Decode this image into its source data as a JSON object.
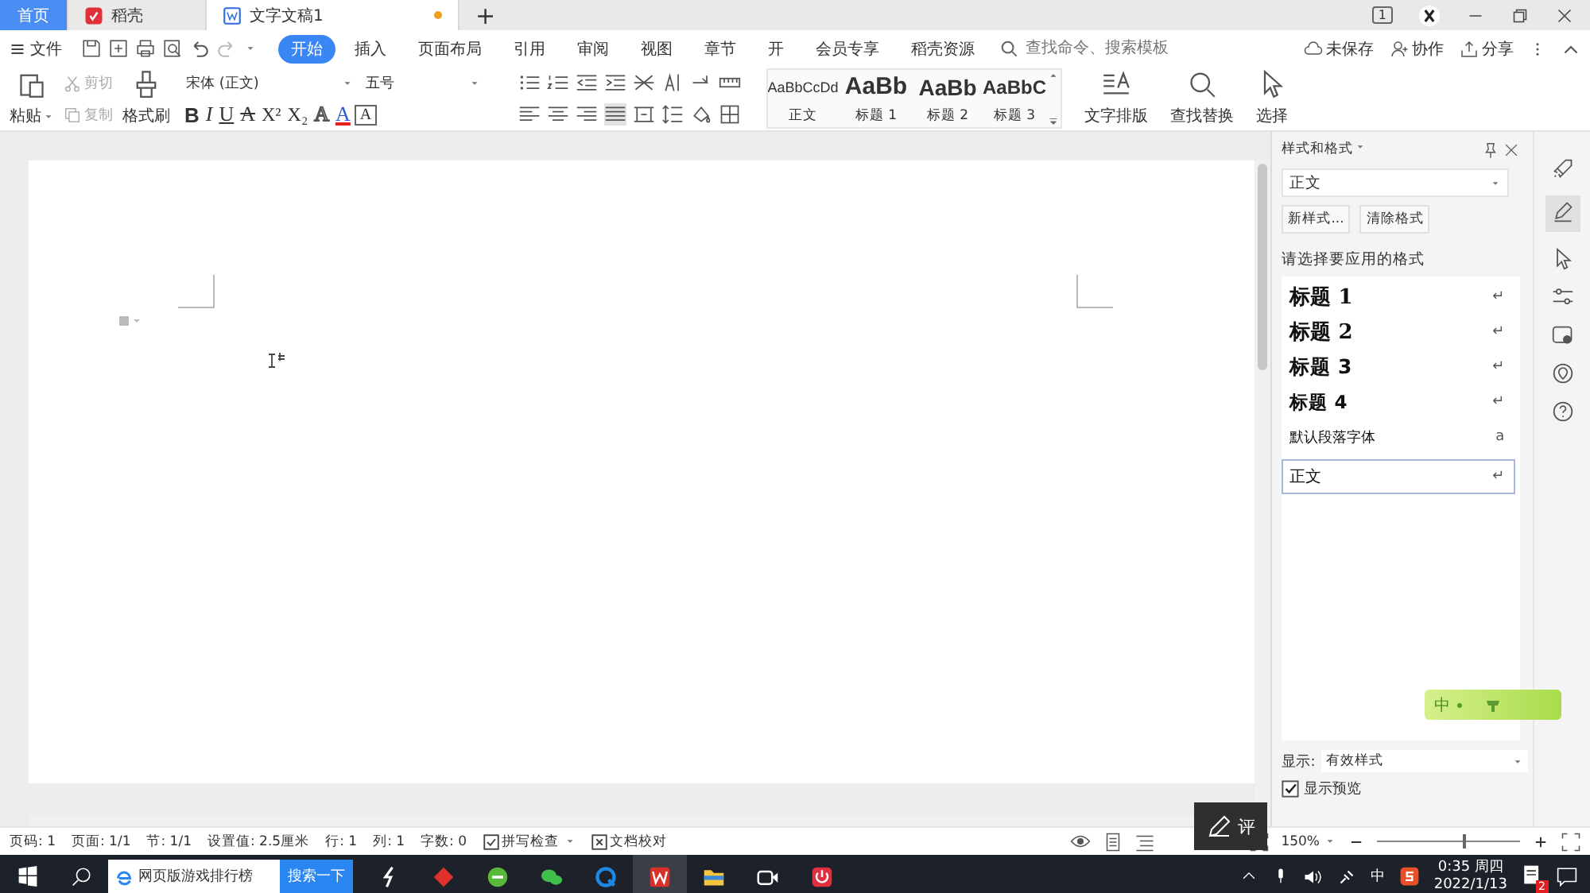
{
  "title_tabs": [
    {
      "label": "首页",
      "kind": "home",
      "selected": false
    },
    {
      "label": "稻壳",
      "kind": "docer",
      "selected": false
    },
    {
      "label": "文字文稿1",
      "kind": "doc",
      "selected": true,
      "unsaved": true
    }
  ],
  "new_tab": "+",
  "window_badge": "1",
  "menu": {
    "file": "文件",
    "tabs": [
      {
        "label": "开始",
        "selected": true
      },
      {
        "label": "插入",
        "selected": false
      },
      {
        "label": "页面布局",
        "selected": false
      },
      {
        "label": "引用",
        "selected": false
      },
      {
        "label": "审阅",
        "selected": false
      },
      {
        "label": "视图",
        "selected": false
      },
      {
        "label": "章节",
        "selected": false
      },
      {
        "label": "开",
        "selected": false
      },
      {
        "label": "会员专享",
        "selected": false
      },
      {
        "label": "稻壳资源",
        "selected": false
      }
    ],
    "search_placeholder": "查找命令、搜索模板",
    "actions": [
      {
        "label": "未保存",
        "kind": "cloud"
      },
      {
        "label": "协作",
        "kind": "user"
      },
      {
        "label": "分享",
        "kind": "share"
      }
    ]
  },
  "ribbon": {
    "paste": "粘贴",
    "cut": {
      "label": "剪切",
      "disabled": true
    },
    "copy": {
      "label": "复制",
      "disabled": true
    },
    "painter": "格式刷",
    "font": "宋体 (正文)",
    "size": "五号",
    "font_buttons": [
      {
        "glyph": "B",
        "kind": "bold"
      },
      {
        "glyph": "I",
        "kind": "italic"
      },
      {
        "glyph": "U",
        "kind": "underline"
      },
      {
        "glyph": "A",
        "kind": "strike"
      },
      {
        "glyph": "X²",
        "kind": "plain"
      },
      {
        "glyph": "X₂",
        "kind": "plain"
      },
      {
        "glyph": "A",
        "kind": "outline"
      },
      {
        "glyph": "A",
        "kind": "color"
      },
      {
        "glyph": "A",
        "kind": "boxed"
      }
    ],
    "styles": [
      {
        "preview": "AaBbCcDd",
        "label": "正文",
        "kind": "normal"
      },
      {
        "preview": "AaBb",
        "label": "标题 1",
        "kind": "h1"
      },
      {
        "preview": "AaBb",
        "label": "标题 2",
        "kind": "h2"
      },
      {
        "preview": "AaBbC",
        "label": "标题 3",
        "kind": "h3"
      }
    ],
    "big_buttons": [
      {
        "label": "文字排版",
        "kind": "layout"
      },
      {
        "label": "查找替换",
        "kind": "find"
      },
      {
        "label": "选择",
        "kind": "select"
      }
    ]
  },
  "panel": {
    "title": "样式和格式",
    "current": "正文",
    "buttons": [
      "新样式...",
      "清除格式"
    ],
    "prompt": "请选择要应用的格式",
    "styles": [
      {
        "label": "标题 1",
        "kind": "h1",
        "mark": "↵",
        "selected": false
      },
      {
        "label": "标题 2",
        "kind": "h2",
        "mark": "↵",
        "selected": false
      },
      {
        "label": "标题 3",
        "kind": "h3",
        "mark": "↵",
        "selected": false
      },
      {
        "label": "标题 4",
        "kind": "h4",
        "mark": "↵",
        "selected": false
      },
      {
        "label": "默认段落字体",
        "kind": "font",
        "mark": "a",
        "selected": false
      },
      {
        "label": "正文",
        "kind": "normal",
        "mark": "↵",
        "selected": true
      }
    ],
    "show_label": "显示:",
    "show_value": "有效样式",
    "preview": {
      "label": "显示预览",
      "checked": true
    }
  },
  "ime_bar": "中",
  "comment_button": "评",
  "status": {
    "items": [
      "页码: 1",
      "页面: 1/1",
      "节: 1/1",
      "设置值: 2.5厘米",
      "行: 1",
      "列: 1",
      "字数: 0"
    ],
    "spell": "拼写检查",
    "proof": "文档校对",
    "zoom": "150%",
    "zoom_slider": {
      "level": 0.6
    }
  },
  "taskbar": {
    "search_text": "网页版游戏排行榜",
    "search_button": "搜索一下",
    "time": "0:35 周四",
    "date": "2022/1/13",
    "ime": "中",
    "notifications": "2"
  }
}
